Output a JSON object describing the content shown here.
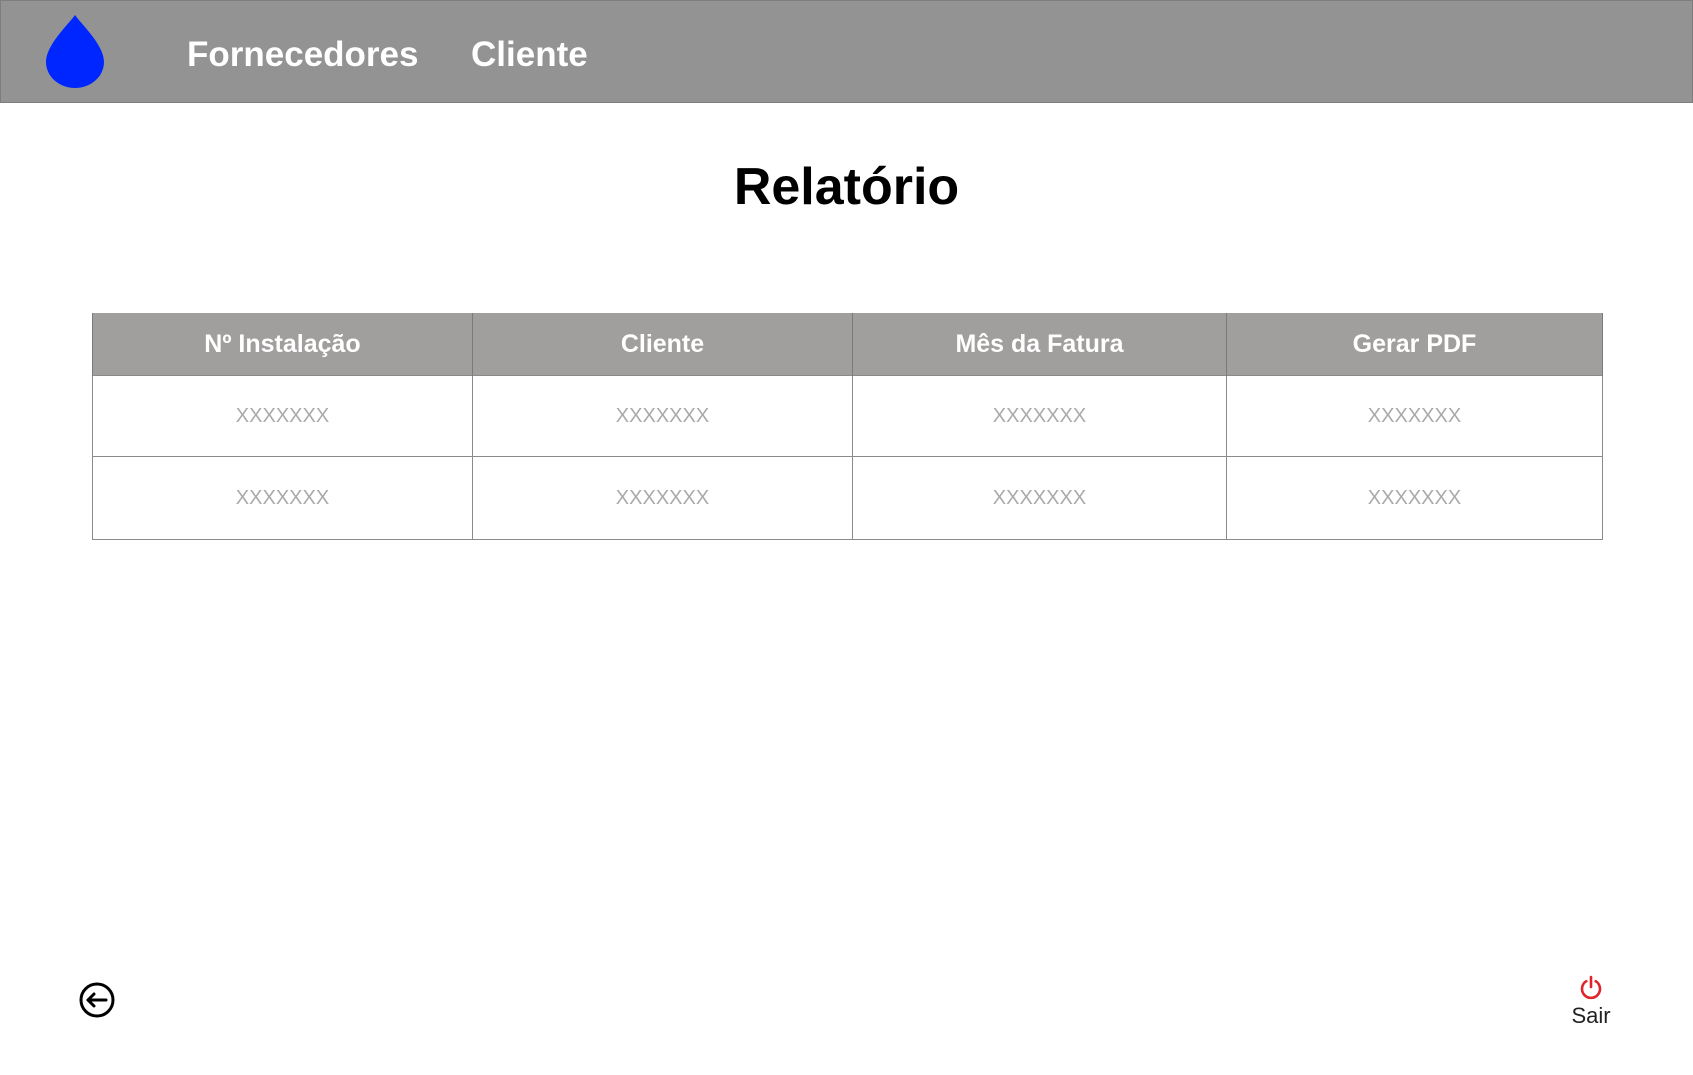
{
  "header": {
    "logo_icon": "water-drop-icon",
    "logo_color": "#0026ff",
    "nav": [
      {
        "label": "Fornecedores"
      },
      {
        "label": "Cliente"
      }
    ]
  },
  "main": {
    "title": "Relatório",
    "table": {
      "columns": [
        "Nº Instalação",
        "Cliente",
        "Mês da Fatura",
        "Gerar PDF"
      ],
      "rows": [
        [
          "XXXXXXX",
          "XXXXXXX",
          "XXXXXXX",
          "XXXXXXX"
        ],
        [
          "XXXXXXX",
          "XXXXXXX",
          "XXXXXXX",
          "XXXXXXX"
        ]
      ]
    }
  },
  "footer": {
    "back_icon": "back-arrow-circle-icon",
    "logout_icon": "power-icon",
    "logout_label": "Sair",
    "logout_color": "#e0242a"
  }
}
